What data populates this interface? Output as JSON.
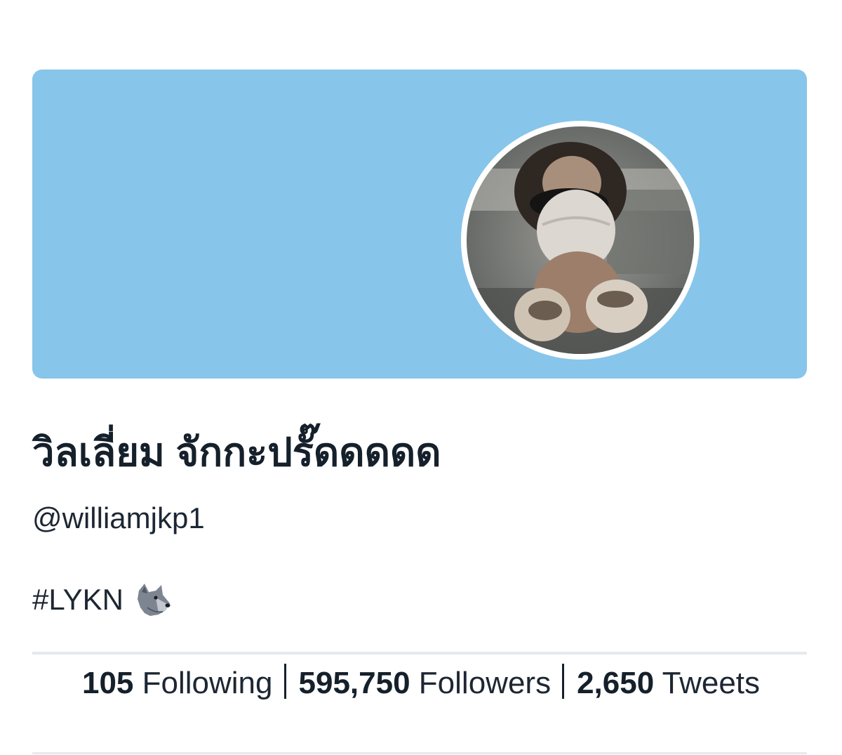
{
  "profile": {
    "display_name": "วิลเลี่ยม จักกะปรั๊ดดดดด",
    "handle": "@williamjkp1",
    "bio_text": "#LYKN",
    "bio_icon": "wolf-icon",
    "banner_color": "#88c5ea"
  },
  "stats": {
    "following_count": "105",
    "following_label": "Following",
    "followers_count": "595,750",
    "followers_label": "Followers",
    "tweets_count": "2,650",
    "tweets_label": "Tweets"
  }
}
